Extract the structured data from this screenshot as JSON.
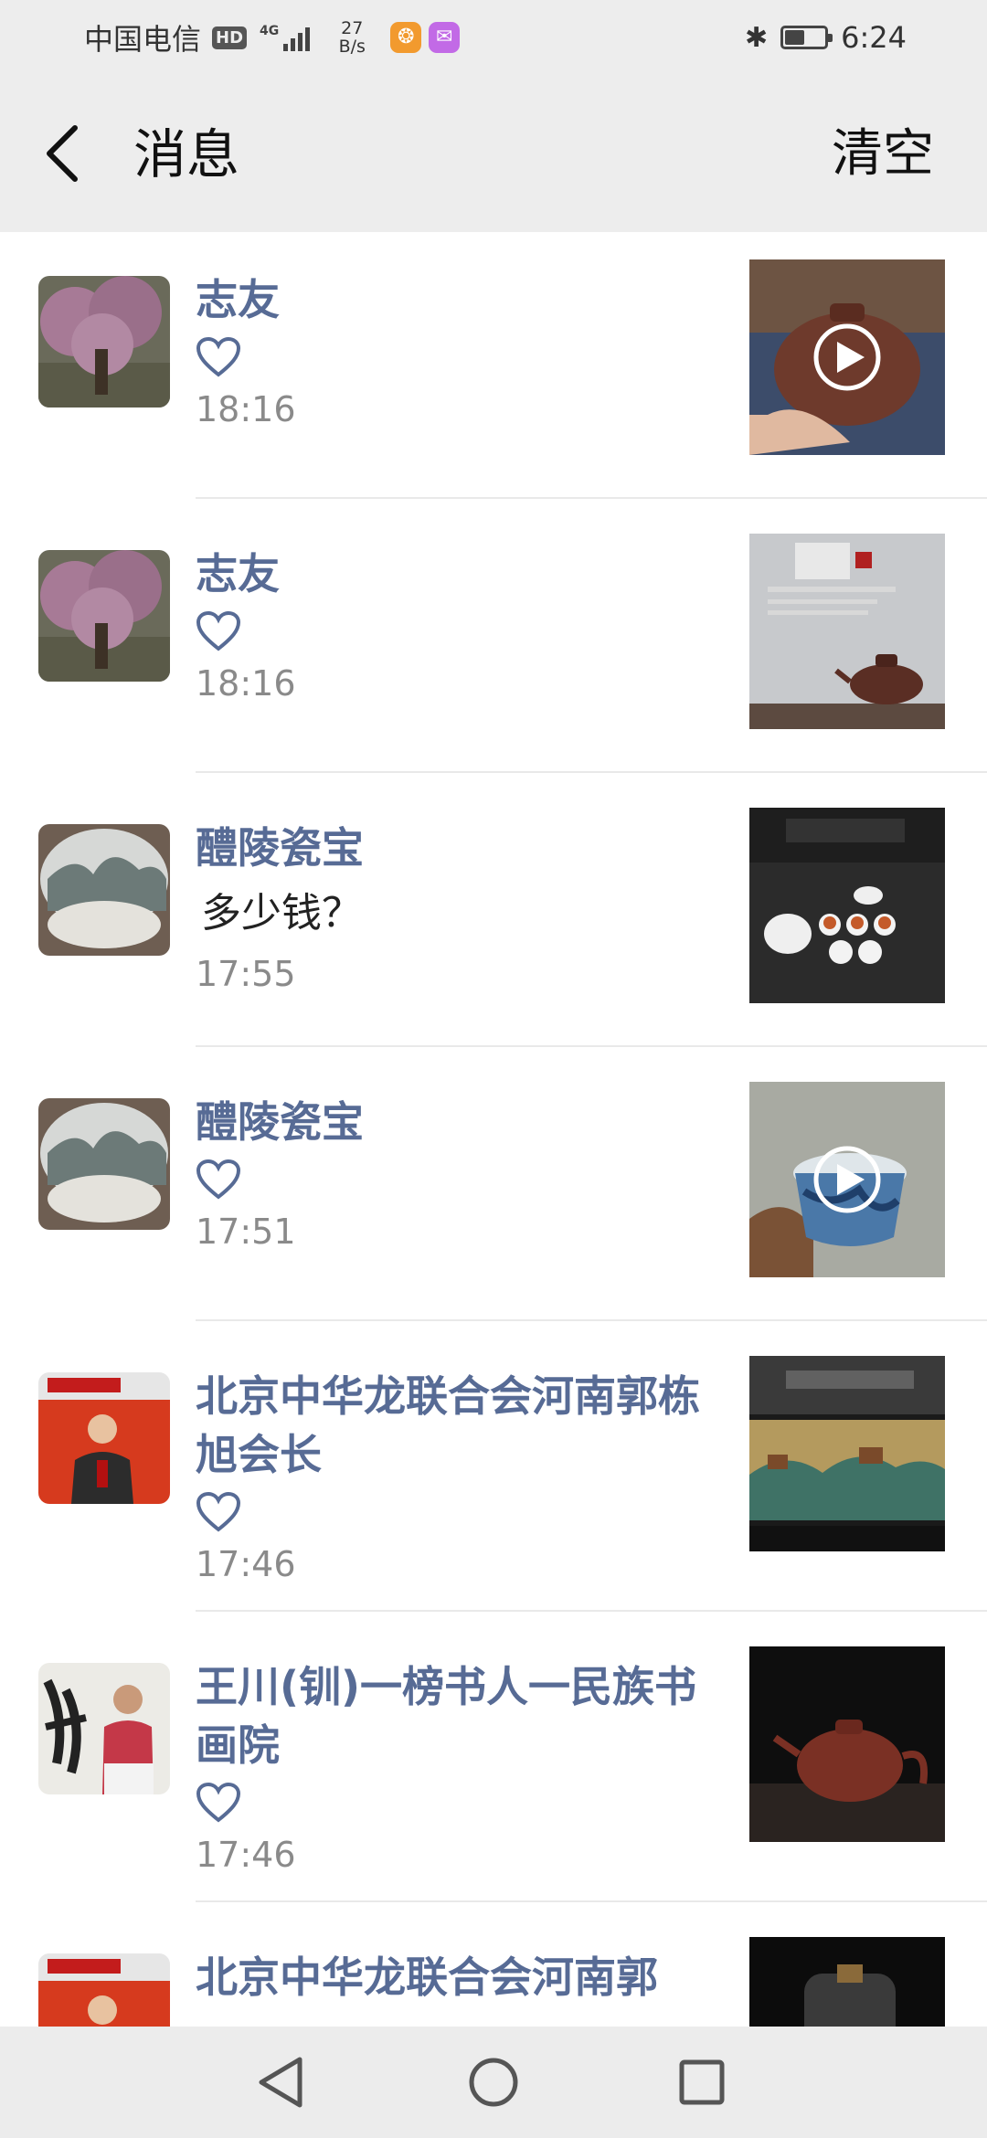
{
  "status_bar": {
    "carrier": "中国电信",
    "hd_badge": "HD",
    "network_tag": "4G",
    "speed_value": "27",
    "speed_unit": "B/s",
    "time": "6:24",
    "battery_level": 0.45,
    "icons": [
      "bluetooth-icon",
      "battery-icon",
      "signal-icon"
    ]
  },
  "header": {
    "title": "消息",
    "clear_label": "清空"
  },
  "messages": [
    {
      "sender": "志友",
      "type": "like",
      "text": "",
      "time": "18:16",
      "thumb": "teapot-video",
      "has_play": true
    },
    {
      "sender": "志友",
      "type": "like",
      "text": "",
      "time": "18:16",
      "thumb": "teapot-poster",
      "has_play": false
    },
    {
      "sender": "醴陵瓷宝",
      "type": "comment",
      "text": "多少钱？",
      "time": "17:55",
      "thumb": "tea-set",
      "has_play": false
    },
    {
      "sender": "醴陵瓷宝",
      "type": "like",
      "text": "",
      "time": "17:51",
      "thumb": "blue-cup-video",
      "has_play": true
    },
    {
      "sender": "北京中华龙联合会河南郭栋旭会长",
      "type": "like",
      "text": "",
      "time": "17:46",
      "thumb": "landscape-scroll",
      "has_play": false
    },
    {
      "sender": "王川(钏)一榜书人一民族书画院",
      "type": "like",
      "text": "",
      "time": "17:46",
      "thumb": "dark-teapot",
      "has_play": false
    },
    {
      "sender": "北京中华龙联合会河南郭",
      "type": "like",
      "text": "",
      "time": "",
      "thumb": "glass-jar",
      "has_play": false
    }
  ],
  "nav": {
    "buttons": [
      "back-triangle-icon",
      "home-circle-icon",
      "recents-square-icon"
    ]
  },
  "colors": {
    "sender_name": "#576b95",
    "background": "#ffffff",
    "header_bg": "#ededed",
    "time_text": "#8a8a8a"
  }
}
